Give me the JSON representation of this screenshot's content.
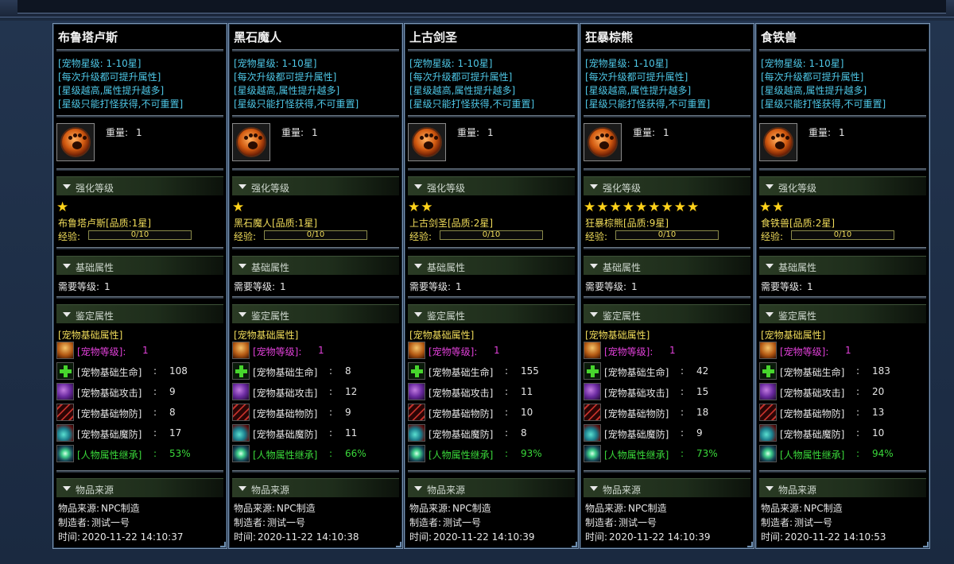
{
  "labels": {
    "weight": "重量:",
    "enhance_section": "强化等级",
    "base_section": "基础属性",
    "identify_section": "鉴定属性",
    "source_section": "物品来源",
    "exp": "经验:",
    "req_level": "需要等级:",
    "pet_base_attrs": "[宠物基础属性]",
    "attr_level": "[宠物等级]:",
    "attr_hp": "[宠物基础生命]",
    "attr_atk": "[宠物基础攻击]",
    "attr_def": "[宠物基础物防]",
    "attr_mdef": "[宠物基础魔防]",
    "attr_inherit": "[人物属性继承]",
    "colon": ":",
    "src_label": "物品来源:",
    "maker_label": "制造者:",
    "time_label": "时间:"
  },
  "description": [
    "[宠物星级: 1-10星]",
    "[每次升级都可提升属性]",
    "[星级越高,属性提升越多]",
    "[星级只能打怪获得,不可重置]"
  ],
  "icons": {
    "item": "paw-icon",
    "collapse": "triangle-down-icon",
    "star": "star-icon",
    "level": "pet-level-icon",
    "hp": "green-cross-icon",
    "atk": "purple-claw-icon",
    "def": "red-slash-icon",
    "mdef": "teal-wing-icon",
    "inherit": "green-swirl-icon"
  },
  "colors": {
    "description": "#4ec7e6",
    "quality": "#f0dc5a",
    "level_attr": "#e040d8",
    "inherit_attr": "#3ad83a",
    "star": "#ffd21a"
  },
  "cards": [
    {
      "name": "布鲁塔卢斯",
      "weight": "1",
      "stars": 1,
      "quality_text": "布鲁塔卢斯[品质:1星]",
      "exp": "0/10",
      "req_level": "1",
      "pet_level": "1",
      "hp": "108",
      "atk": "9",
      "def": "8",
      "mdef": "17",
      "inherit": "53%",
      "source": "NPC制造",
      "maker": "测试一号",
      "time": "2020-11-22 14:10:37"
    },
    {
      "name": "黑石魔人",
      "weight": "1",
      "stars": 1,
      "quality_text": "黑石魔人[品质:1星]",
      "exp": "0/10",
      "req_level": "1",
      "pet_level": "1",
      "hp": "8",
      "atk": "12",
      "def": "9",
      "mdef": "11",
      "inherit": "66%",
      "source": "NPC制造",
      "maker": "测试一号",
      "time": "2020-11-22 14:10:38"
    },
    {
      "name": "上古剑圣",
      "weight": "1",
      "stars": 2,
      "quality_text": "上古剑圣[品质:2星]",
      "exp": "0/10",
      "req_level": "1",
      "pet_level": "1",
      "hp": "155",
      "atk": "11",
      "def": "10",
      "mdef": "8",
      "inherit": "93%",
      "source": "NPC制造",
      "maker": "测试一号",
      "time": "2020-11-22 14:10:39"
    },
    {
      "name": "狂暴棕熊",
      "weight": "1",
      "stars": 9,
      "quality_text": "狂暴棕熊[品质:9星]",
      "exp": "0/10",
      "req_level": "1",
      "pet_level": "1",
      "hp": "42",
      "atk": "15",
      "def": "18",
      "mdef": "9",
      "inherit": "73%",
      "source": "NPC制造",
      "maker": "测试一号",
      "time": "2020-11-22 14:10:39"
    },
    {
      "name": "食铁兽",
      "weight": "1",
      "stars": 2,
      "quality_text": "食铁兽[品质:2星]",
      "exp": "0/10",
      "req_level": "1",
      "pet_level": "1",
      "hp": "183",
      "atk": "20",
      "def": "13",
      "mdef": "10",
      "inherit": "94%",
      "source": "NPC制造",
      "maker": "测试一号",
      "time": "2020-11-22 14:10:53"
    }
  ]
}
